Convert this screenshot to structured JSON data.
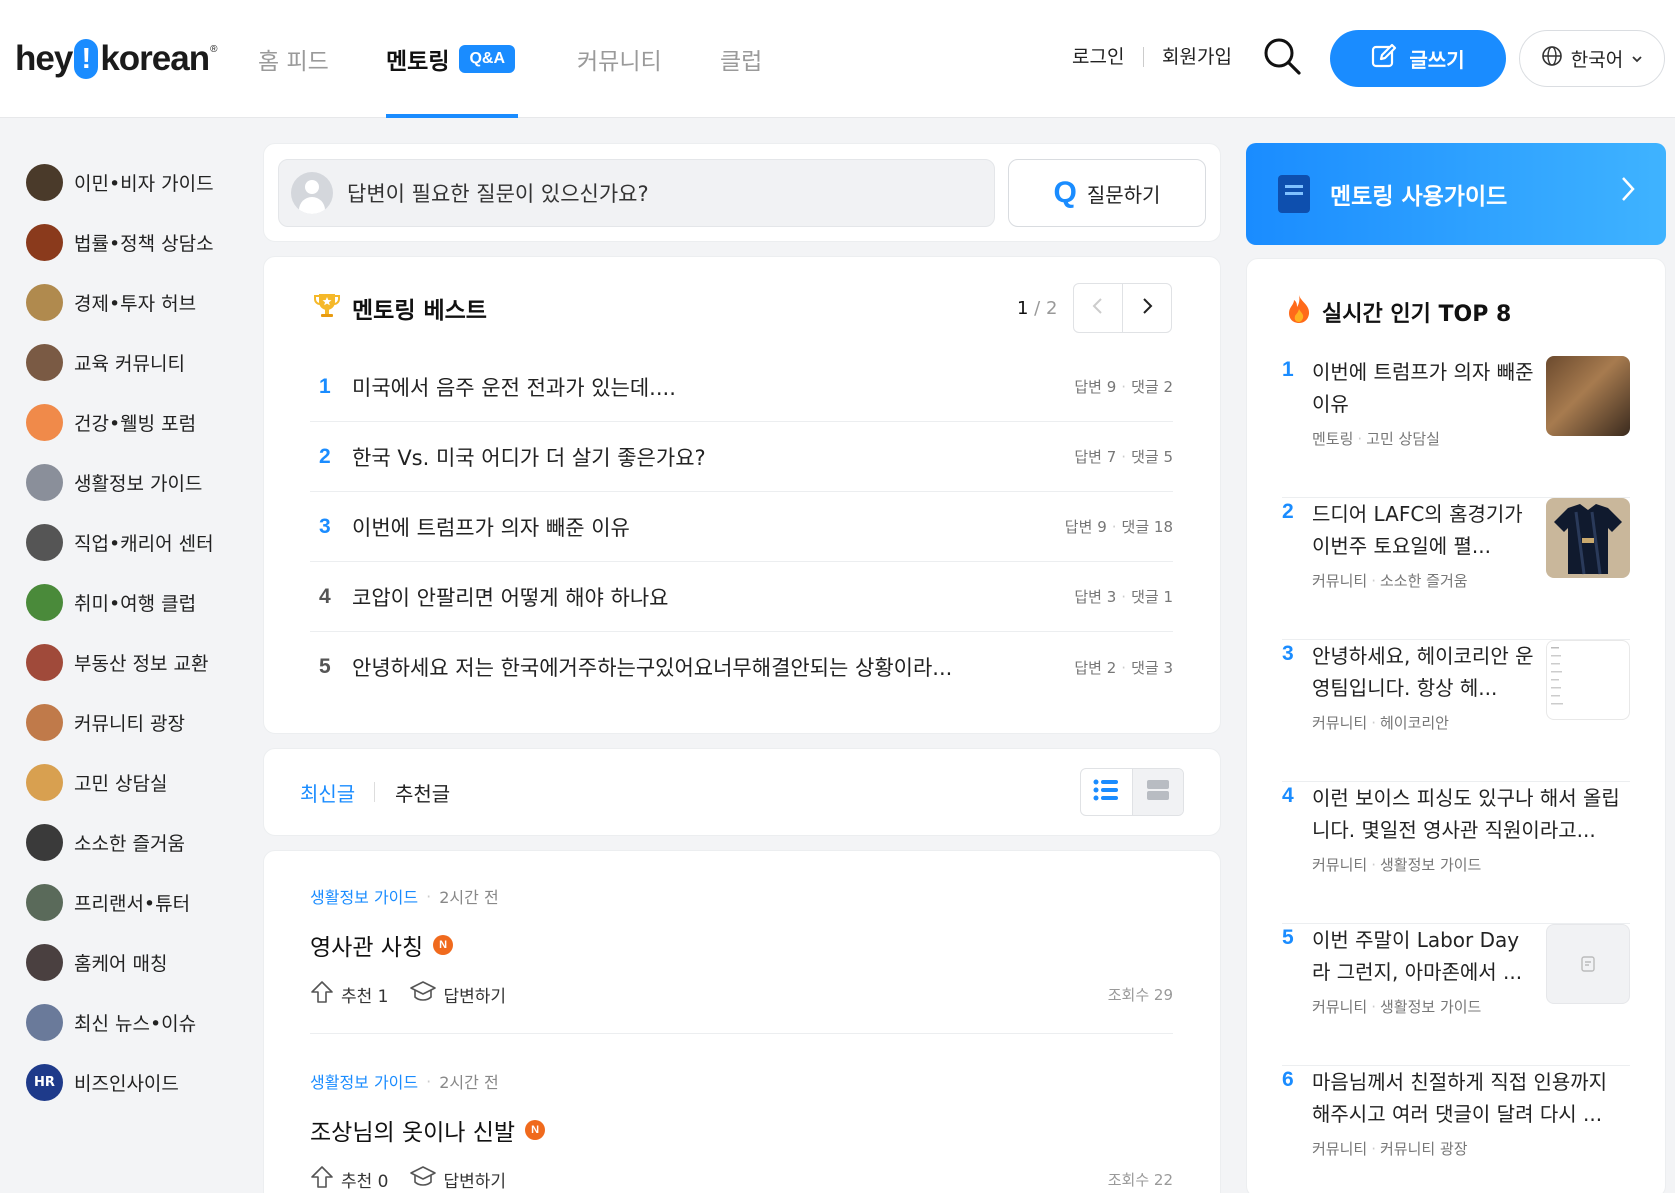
{
  "header": {
    "logo_left": "hey",
    "logo_bang": "!",
    "logo_right": "korean",
    "logo_mark": "®",
    "nav": {
      "home": "홈 피드",
      "mentoring": "멘토링",
      "mentoring_badge": "Q&A",
      "community": "커뮤니티",
      "club": "클럽"
    },
    "login": "로그인",
    "signup": "회원가입",
    "write_button": "글쓰기",
    "language": "한국어"
  },
  "sidebar": {
    "items": [
      {
        "label": "이민•비자 가이드",
        "color": "#4a3a2a"
      },
      {
        "label": "법률•정책 상담소",
        "color": "#8a3a1c"
      },
      {
        "label": "경제•투자 허브",
        "color": "#b08a4e"
      },
      {
        "label": "교육 커뮤니티",
        "color": "#7a5a44"
      },
      {
        "label": "건강•웰빙 포럼",
        "color": "#f08a4a"
      },
      {
        "label": "생활정보 가이드",
        "color": "#8a8f9a"
      },
      {
        "label": "직업•캐리어 센터",
        "color": "#555555"
      },
      {
        "label": "취미•여행 클럽",
        "color": "#4a8a3a"
      },
      {
        "label": "부동산 정보 교환",
        "color": "#a04a3a"
      },
      {
        "label": "커뮤니티 광장",
        "color": "#c07a4a"
      },
      {
        "label": "고민 상담실",
        "color": "#d8a050"
      },
      {
        "label": "소소한 즐거움",
        "color": "#3a3a3a"
      },
      {
        "label": "프리랜서•튜터",
        "color": "#5a6a5a"
      },
      {
        "label": "홈케어 매칭",
        "color": "#4a4040"
      },
      {
        "label": "최신 뉴스•이슈",
        "color": "#6a7a9a"
      },
      {
        "label": "비즈인사이드",
        "color": "#1e3a8a",
        "badge": "HR"
      }
    ]
  },
  "ask": {
    "placeholder": "답변이 필요한 질문이 있으신가요?",
    "button_icon": "Q",
    "button_label": "질문하기"
  },
  "best": {
    "title": "멘토링 베스트",
    "page_current": "1",
    "page_sep": " / ",
    "page_total": "2",
    "answer_label": "답변",
    "comment_label": "댓글",
    "items": [
      {
        "rank": "1",
        "title": "미국에서 음주 운전 전과가 있는데....",
        "answers": "9",
        "comments": "2",
        "rank_color": "#1a8cff"
      },
      {
        "rank": "2",
        "title": "한국 Vs. 미국 어디가 더 살기 좋은가요?",
        "answers": "7",
        "comments": "5",
        "rank_color": "#1a8cff"
      },
      {
        "rank": "3",
        "title": "이번에 트럼프가 의자 빼준 이유",
        "answers": "9",
        "comments": "18",
        "rank_color": "#1a8cff"
      },
      {
        "rank": "4",
        "title": "코압이 안팔리면 어떻게 해야 하나요",
        "answers": "3",
        "comments": "1",
        "rank_color": "#555555"
      },
      {
        "rank": "5",
        "title": "안녕하세요 저는 한국에거주하는구있어요너무해결안되는 상황이라...",
        "answers": "2",
        "comments": "3",
        "rank_color": "#555555"
      }
    ]
  },
  "feed_tabs": {
    "recent": "최신글",
    "recommended": "추천글"
  },
  "feed": {
    "posts": [
      {
        "category": "생활정보 가이드",
        "time": "2시간 전",
        "title": "영사관 사칭",
        "badge": "N",
        "upvote": "추천 1",
        "answer": "답변하기",
        "views": "조회수 29"
      },
      {
        "category": "생활정보 가이드",
        "time": "2시간 전",
        "title": "조상님의 옷이나 신발",
        "badge": "N",
        "upvote": "추천 0",
        "answer": "답변하기",
        "views": "조회수 22"
      }
    ]
  },
  "guide_banner": {
    "label": "멘토링 사용가이드"
  },
  "popular": {
    "title": "실시간 인기 TOP 8",
    "items": [
      {
        "rank": "1",
        "title": "이번에 트럼프가 의자 빼준 이유",
        "board": "멘토링",
        "sub": "고민 상담실",
        "thumb": "photo"
      },
      {
        "rank": "2",
        "title": "드디어 LAFC의 홈경기가 이번주 토요일에 펼...",
        "board": "커뮤니티",
        "sub": "소소한 즐거움",
        "thumb": "jersey"
      },
      {
        "rank": "3",
        "title": "안녕하세요, 헤이코리안 운영팀입니다. 항상 헤...",
        "board": "커뮤니티",
        "sub": "헤이코리안",
        "thumb": "doc"
      },
      {
        "rank": "4",
        "title": "이런 보이스 피싱도 있구나 해서 올립니다. 몇일전 영사관 직원이라고...",
        "board": "커뮤니티",
        "sub": "생활정보 가이드",
        "thumb": ""
      },
      {
        "rank": "5",
        "title": "이번 주말이 Labor Day 라 그런지, 아마존에서 ...",
        "board": "커뮤니티",
        "sub": "생활정보 가이드",
        "thumb": "placeholder"
      },
      {
        "rank": "6",
        "title": "마음님께서 친절하게 직접 인용까지 해주시고 여러 댓글이 달려 다시 ...",
        "board": "커뮤니티",
        "sub": "커뮤니티 광장",
        "thumb": ""
      }
    ]
  },
  "colors": {
    "accent": "#1a8cff",
    "new_badge": "#f06a1d",
    "banner_start": "#1a8cff",
    "banner_end": "#3fb3ff"
  }
}
